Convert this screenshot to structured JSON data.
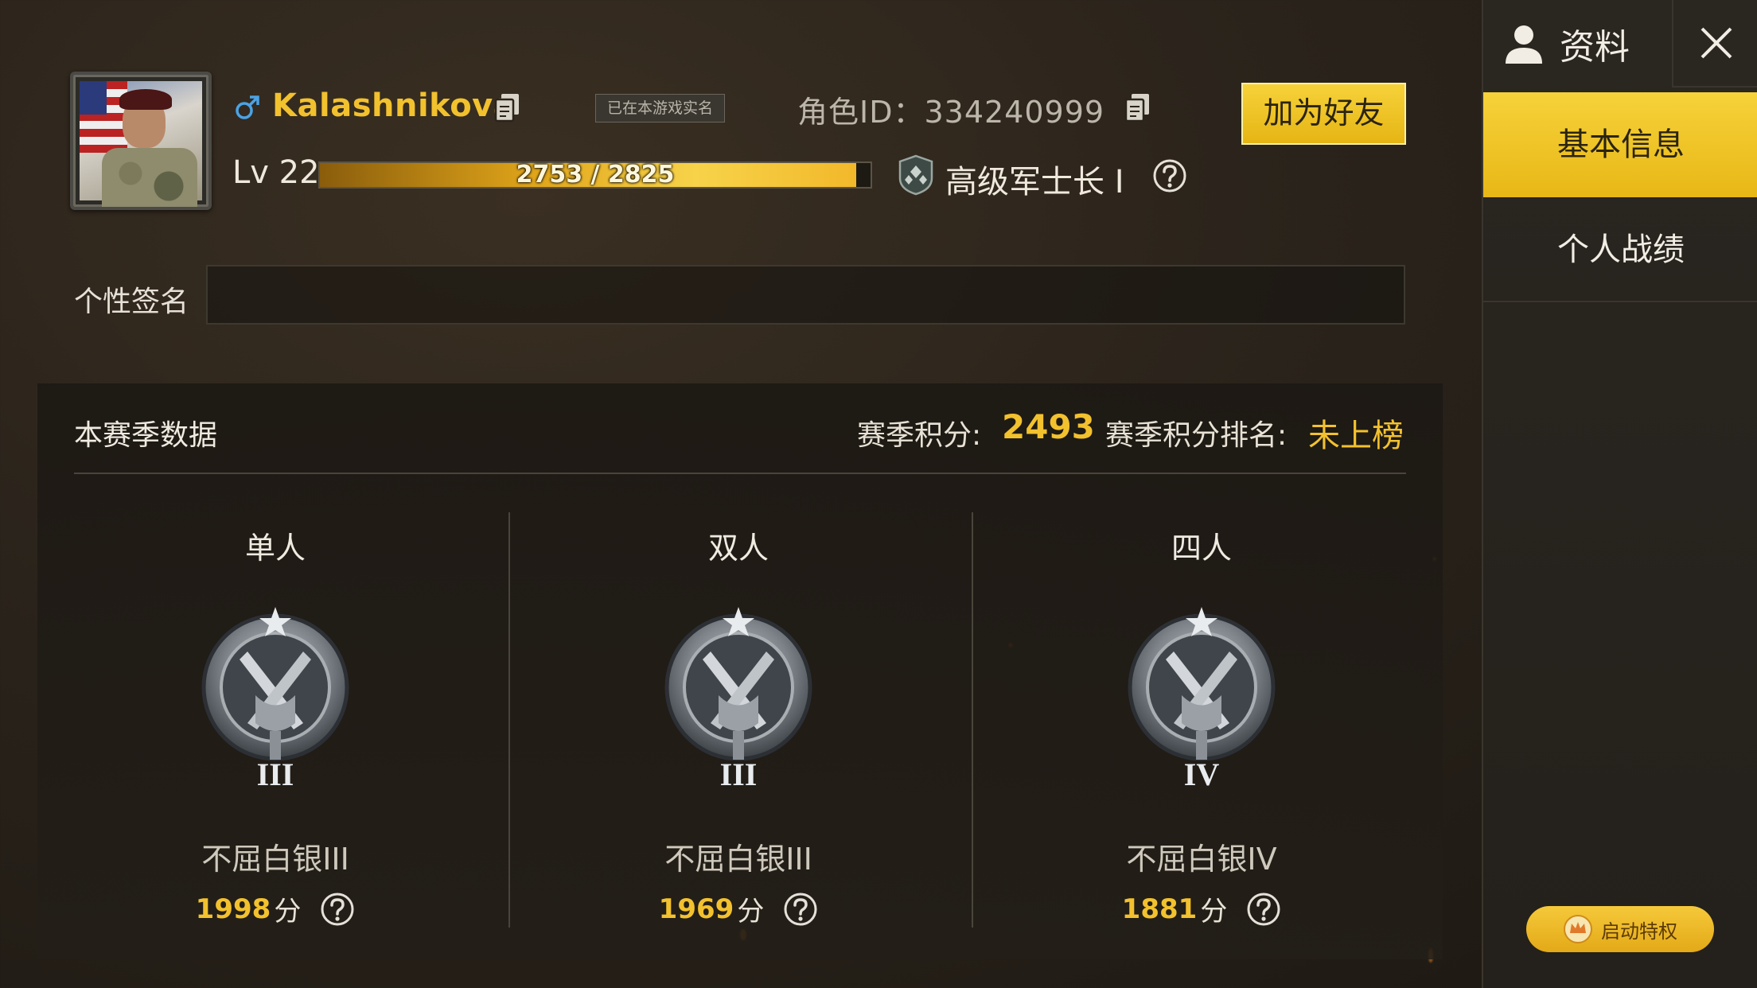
{
  "profile": {
    "gender_icon": "male-icon",
    "name": "Kalashnikova",
    "verified_label": "已在本游戏实名",
    "role_id_text": "角色ID：334240999",
    "add_friend_label": "加为好友",
    "level_label": "Lv 22",
    "exp_text": "2753 / 2825",
    "exp_current": 2753,
    "exp_max": 2825,
    "military_rank": "高级军士长 I",
    "signature_label": "个性签名",
    "signature_value": ""
  },
  "season": {
    "title": "本赛季数据",
    "score_label": "赛季积分:",
    "score_value": "2493",
    "rank_label": "赛季积分排名:",
    "rank_value": "未上榜",
    "modes": [
      {
        "title": "单人",
        "tier_numeral": "III",
        "tier_name": "不屈白银III",
        "score": "1998",
        "score_unit": "分"
      },
      {
        "title": "双人",
        "tier_numeral": "III",
        "tier_name": "不屈白银III",
        "score": "1969",
        "score_unit": "分"
      },
      {
        "title": "四人",
        "tier_numeral": "IV",
        "tier_name": "不屈白银IV",
        "score": "1881",
        "score_unit": "分"
      }
    ]
  },
  "sidebar": {
    "title": "资料",
    "tabs": [
      {
        "label": "基本信息",
        "active": true
      },
      {
        "label": "个人战绩",
        "active": false
      }
    ],
    "privilege_label": "启动特权"
  },
  "colors": {
    "accent": "#f2c12e",
    "active_tab": "#f6d23a",
    "background": "#2a231b"
  }
}
